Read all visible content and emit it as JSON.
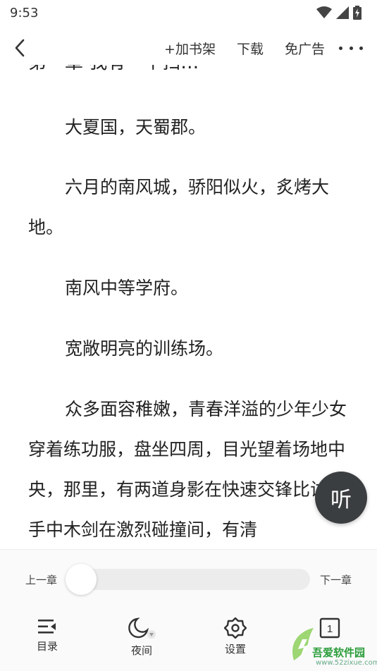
{
  "status_bar": {
    "time": "9:53",
    "icons": [
      "wifi-icon",
      "signal-icon",
      "battery-charging-icon"
    ]
  },
  "toolbar": {
    "add_bookshelf": "+加书架",
    "download": "下载",
    "ad_free": "免广告"
  },
  "content": {
    "clipped_top_line": "第一章 我有一个扫…",
    "paragraphs": [
      "大夏国，天蜀郡。",
      "六月的南风城，骄阳似火，炙烤大地。",
      "南风中等学府。",
      "宽敞明亮的训练场。",
      "众多面容稚嫩，青春洋溢的少年少女穿着练功服，盘坐四周，目光望着场地中央，那里，有两道身影在快速交锋比试，手中木剑在激烈碰撞间，有清"
    ]
  },
  "listen_button": {
    "label": "听"
  },
  "bottom_panel": {
    "prev_chapter": "上一章",
    "next_chapter": "下一章",
    "progress": 0.0,
    "menu": [
      {
        "label": "目录",
        "icon": "toc-icon"
      },
      {
        "label": "夜间",
        "icon": "night-mode-icon"
      },
      {
        "label": "设置",
        "icon": "settings-icon"
      },
      {
        "label": "",
        "icon": "page-mode-icon",
        "badge": "1"
      }
    ]
  },
  "watermark": {
    "name": "吾爱软件园",
    "site": "www.52zixue.com"
  },
  "colors": {
    "text": "#222222",
    "listen_bg": "#3b3e40",
    "track": "#ececec",
    "watermark": "#2a9d3a"
  }
}
